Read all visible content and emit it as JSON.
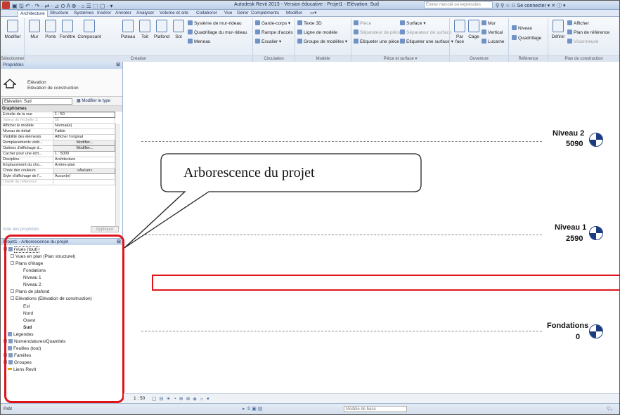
{
  "titlebar": {
    "qat": "▣ 🖫 ↶ · ↷ · ⇄ · ⊿ ⊙ A ⊕ · ⌂ ☰ ⬚ ▢ · ▾",
    "title": "Autodesk Revit 2013 - Version éducative -   Projet1 - Elévation: Sud",
    "search_placeholder": "Entrez mot-clé ou expression",
    "right": "⚲ ⚲ ☆ ⚇ Se connecter  ▾  ✕  ⓘ ▾"
  },
  "tabs": [
    "Architecture",
    "Structure",
    "Systèmes",
    "Insérer",
    "Annoter",
    "Analyser",
    "Volume et site",
    "Collaborer",
    "Vue",
    "Gérer",
    "Compléments",
    "Modifier",
    "▭▾"
  ],
  "ribbon": {
    "buttons": {
      "modifier": "Modifier",
      "mur": "Mur",
      "porte": "Porte",
      "fenetre": "Fenêtre",
      "composant": "Composant",
      "poteau": "Poteau",
      "toit": "Toit",
      "plafond": "Plafond",
      "sol": "Sol",
      "par_face": "Par face",
      "cage": "Cage",
      "definir": "Définir"
    },
    "small": {
      "sys_mur_rideau": "Système de mur-rideau",
      "quad_mur_rideau": "Quadrillage du mur-rideau",
      "meneau": "Meneau",
      "garde_corps": "Garde-corps ▾",
      "rampe": "Rampe d'accès",
      "escalier": "Escalier ▾",
      "texte3d": "Texte 3D",
      "ligne_modele": "Ligne de modèle",
      "groupe_modeles": "Groupe de modèles ▾",
      "piece": "Pièce",
      "separateur_pieces": "Séparateur de pièces",
      "etiqueter_piece": "Etiqueter une pièce ▾",
      "surface": "Surface ▾",
      "separateur_surface": "Séparateur de surface",
      "etiqueter_surface": "Etiqueter une surface ▾",
      "mur_small": "Mur",
      "vertical": "Vertical",
      "lucarne": "Lucarne",
      "niveau": "Niveau",
      "quadrillage": "Quadrillage",
      "afficher": "Afficher",
      "plan_ref": "Plan de référence",
      "visionneuse": "Visionneuse"
    },
    "groups": {
      "selectionner": "Sélectionner",
      "creation": "Création",
      "circulation": "Circulation",
      "modele": "Modèle",
      "piece_surface": "Pièce et surface ▾",
      "ouverture": "Ouverture",
      "reference": "Référence",
      "plan_construction": "Plan de construction"
    }
  },
  "properties": {
    "header": "Propriétés",
    "type_line1": "Elévation",
    "type_line2": "Elévation de construction",
    "selector": "Elévation: Sud",
    "edit_type": "Modifier le type",
    "section": "Graphismes",
    "rows": [
      {
        "k": "Echelle de la vue",
        "v": "1 : 50"
      },
      {
        "k": "Valeur de l'échelle   1:",
        "v": "50"
      },
      {
        "k": "Afficher le modèle",
        "v": "Normal(e)"
      },
      {
        "k": "Niveau de détail",
        "v": "Faible"
      },
      {
        "k": "Visibilité des éléments",
        "v": "Afficher l'original"
      },
      {
        "k": "Remplacements visib...",
        "v": "Modifier..."
      },
      {
        "k": "Options d'affichage d...",
        "v": "Modifier..."
      },
      {
        "k": "Cacher pour une éch...",
        "v": "1 : 5000"
      },
      {
        "k": "Discipline",
        "v": "Architecture"
      },
      {
        "k": "Emplacement du cho...",
        "v": "Arrière-plan"
      },
      {
        "k": "Choix des couleurs",
        "v": "<Aucun>"
      },
      {
        "k": "Style d'affichage de l'...",
        "v": "Aucun(e)"
      },
      {
        "k": "Libellé de référence",
        "v": ""
      }
    ],
    "help_link": "Aide des propriétés",
    "apply": "Appliquer"
  },
  "browser": {
    "header": "Projet1 - Arborescence du projet",
    "nodes": [
      {
        "label": "Vues (tout)"
      },
      {
        "label": "Vues en plan (Plan structurel)"
      },
      {
        "label": "Plans d'étage"
      },
      {
        "label": "Fondations"
      },
      {
        "label": "Niveau 1"
      },
      {
        "label": "Niveau 2"
      },
      {
        "label": "Plans de plafond"
      },
      {
        "label": "Elévations (Elévation de construction)"
      },
      {
        "label": "Est"
      },
      {
        "label": "Nord"
      },
      {
        "label": "Ouest"
      },
      {
        "label": "Sud"
      },
      {
        "label": "Légendes"
      },
      {
        "label": "Nomenclatures/Quantités"
      },
      {
        "label": "Feuilles (tout)"
      },
      {
        "label": "Familles"
      },
      {
        "label": "Groupes"
      },
      {
        "label": "Liens Revit"
      }
    ]
  },
  "levels": [
    {
      "name": "Niveau 2",
      "value": "5090"
    },
    {
      "name": "Niveau 1",
      "value": "2590"
    },
    {
      "name": "Fondations",
      "value": "0"
    }
  ],
  "callout": "Arborescence du projet",
  "viewbar": {
    "scale": "1 : 50",
    "icons": "▢ ⊟ ☀ ◔ ⊕ ⊗ ◈ ☼ ▾"
  },
  "status": {
    "text": "Prêt",
    "mid": "▸   :0   ▣ ▤",
    "model": "Modèle de base",
    "right": "▽₀"
  },
  "colors": {
    "highlight": "#e0131b",
    "ribbon": "#dfe8f4"
  }
}
